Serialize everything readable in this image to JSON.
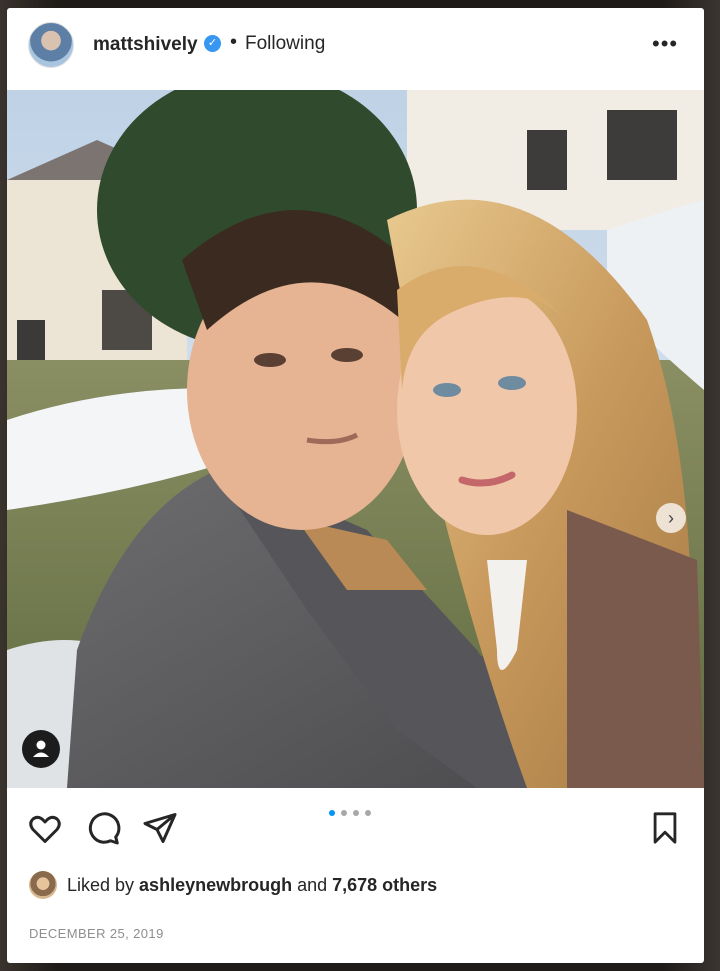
{
  "post": {
    "username": "mattshively",
    "verified_icon": "verified-badge-icon",
    "separator": "•",
    "follow_status": "Following",
    "more_icon": "more-options-icon",
    "image": {
      "alt": "selfie",
      "carousel_total": 4,
      "carousel_current": 1
    },
    "actions": {
      "like_icon": "heart-icon",
      "comment_icon": "comment-icon",
      "share_icon": "paper-plane-icon",
      "save_icon": "bookmark-icon"
    },
    "likes": {
      "prefix": "Liked by ",
      "liker": "ashleynewbrough",
      "middle": " and ",
      "count": "7,678 others"
    },
    "date": "DECEMBER 25, 2019"
  },
  "colors": {
    "accent": "#0095f6",
    "verified": "#3897f0",
    "text": "#262626",
    "muted": "#8e8e8e"
  }
}
